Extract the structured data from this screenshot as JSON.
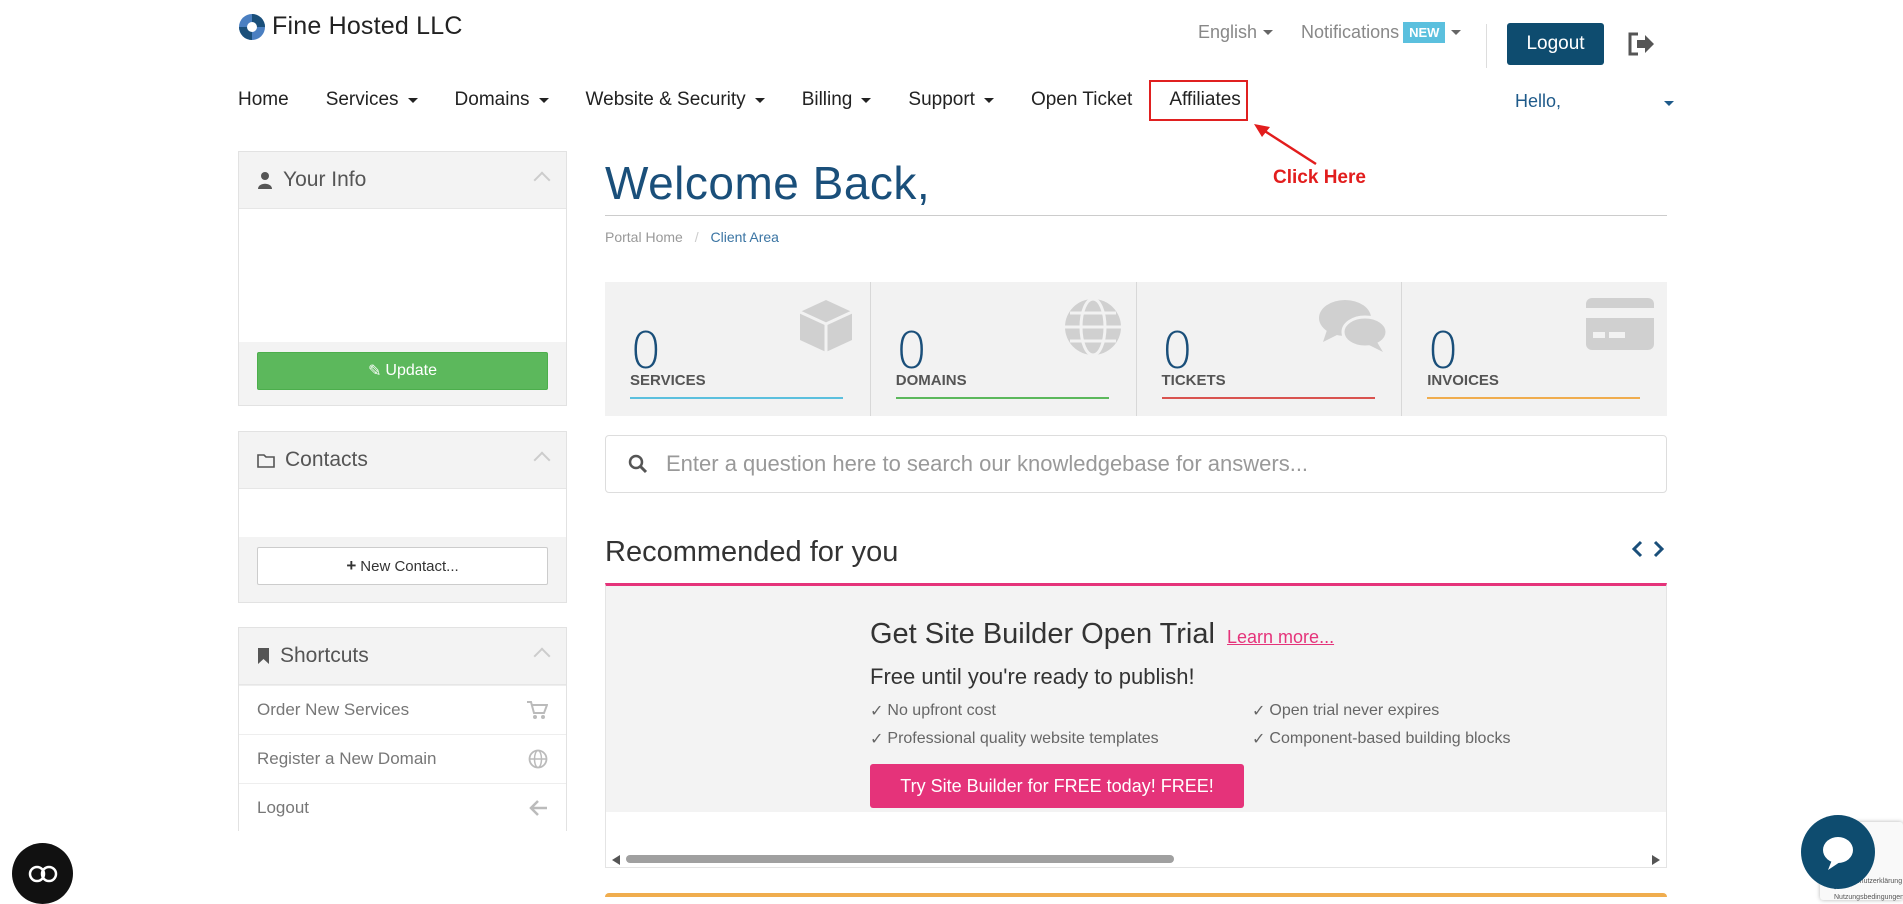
{
  "header": {
    "brand": "Fine Hosted LLC",
    "language": "English",
    "notifications": "Notifications",
    "notifications_badge": "NEW",
    "logout": "Logout"
  },
  "nav": {
    "items": [
      "Home",
      "Services",
      "Domains",
      "Website & Security",
      "Billing",
      "Support",
      "Open Ticket",
      "Affiliates"
    ],
    "greeting": "Hello,"
  },
  "annotation": {
    "text": "Click Here",
    "color": "#e21d1d"
  },
  "sidebar": {
    "your_info": {
      "title": "Your Info",
      "button": "Update"
    },
    "contacts": {
      "title": "Contacts",
      "button": "New Contact..."
    },
    "shortcuts": {
      "title": "Shortcuts",
      "items": [
        {
          "label": "Order New Services",
          "icon": "cart-icon"
        },
        {
          "label": "Register a New Domain",
          "icon": "globe-icon"
        },
        {
          "label": "Logout",
          "icon": "arrow-left-icon"
        }
      ]
    }
  },
  "main": {
    "welcome": "Welcome Back,",
    "breadcrumb": {
      "home": "Portal Home",
      "sep": "/",
      "current": "Client Area"
    },
    "stats": [
      {
        "value": "0",
        "label": "SERVICES",
        "color": "#5bc0de",
        "icon": "cube-icon"
      },
      {
        "value": "0",
        "label": "DOMAINS",
        "color": "#5cb85c",
        "icon": "globe-icon"
      },
      {
        "value": "0",
        "label": "TICKETS",
        "color": "#d9534f",
        "icon": "comments-icon"
      },
      {
        "value": "0",
        "label": "INVOICES",
        "color": "#f0ad4e",
        "icon": "credit-card-icon"
      }
    ],
    "search_placeholder": "Enter a question here to search our knowledgebase for answers...",
    "recommended": {
      "title": "Recommended for you",
      "card_title": "Get Site Builder Open Trial",
      "learn_more": "Learn more...",
      "subtitle": "Free until you're ready to publish!",
      "features": [
        "No upfront cost",
        "Open trial never expires",
        "Professional quality website templates",
        "Component-based building blocks"
      ],
      "cta": "Try Site Builder for FREE today! FREE!"
    }
  },
  "colors": {
    "primary": "#0e4c6f",
    "accent": "#e5337a",
    "green": "#5cb85c"
  },
  "recaptcha_text": "Datenschutzerklärung - Nutzungsbedingungen"
}
